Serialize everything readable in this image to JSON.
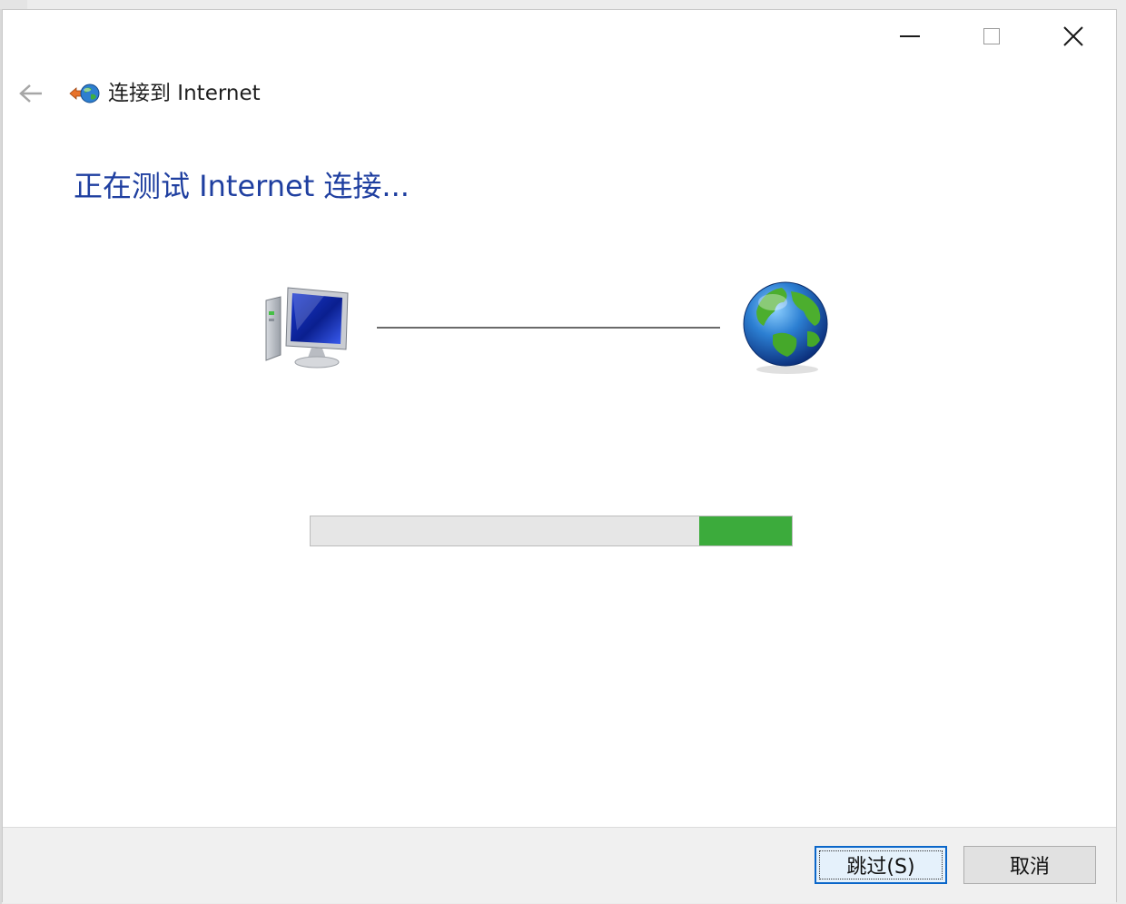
{
  "window": {
    "title": "连接到 Internet",
    "heading": "正在测试 Internet 连接..."
  },
  "caption_buttons": {
    "minimize": "minimize-icon",
    "maximize": "maximize-icon",
    "close": "close-icon"
  },
  "icons": {
    "back": "back-arrow-icon",
    "header": "network-globe-icon",
    "computer": "computer-icon",
    "internet": "globe-icon"
  },
  "progress": {
    "state": "marquee",
    "segment_start": 0.808,
    "segment_end": 1.0,
    "fill_color": "#3cab3c"
  },
  "footer": {
    "skip_label": "跳过(S)",
    "cancel_label": "取消"
  },
  "colors": {
    "heading": "#1f3fa0",
    "focus_border": "#0a66c9"
  }
}
